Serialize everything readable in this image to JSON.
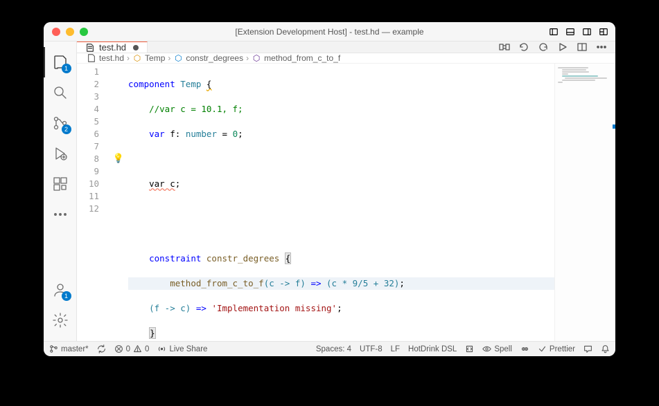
{
  "title": "[Extension Development Host] - test.hd — example",
  "badges": {
    "explorer": "1",
    "scm": "2",
    "accounts": "1"
  },
  "tab": {
    "label": "test.hd"
  },
  "breadcrumbs": {
    "file": "test.hd",
    "sym1": "Temp",
    "sym2": "constr_degrees",
    "sym3": "method_from_c_to_f"
  },
  "code": {
    "kw_component": "component",
    "name_temp": "Temp",
    "brace_open": "{",
    "cmt1": "//var c = 10.1, f;",
    "kw_var1": "var",
    "id_f": "f",
    "colon": ":",
    "type_num": "number",
    "eq": "=",
    "zero": "0",
    "semi": ";",
    "id_var_c": "var c",
    "kw_constraint": "constraint",
    "name_constr": "constr_degrees",
    "method_name": "method_from_c_to_f",
    "sig_cf": "(c -> f)",
    "arrow": "=>",
    "expr": "(c * 9/5 + 32)",
    "sig_fc": "(f -> c)",
    "str_missing": "'Implementation missing'",
    "brace_match": "{",
    "brace_match2": "}",
    "brace_close": "}"
  },
  "lines": {
    "l1": "1",
    "l2": "2",
    "l3": "3",
    "l4": "4",
    "l5": "5",
    "l6": "6",
    "l7": "7",
    "l8": "8",
    "l9": "9",
    "l10": "10",
    "l11": "11",
    "l12": "12"
  },
  "statusbar": {
    "branch": "master*",
    "errors": "0",
    "warnings": "0",
    "liveshare": "Live Share",
    "spaces": "Spaces: 4",
    "encoding": "UTF-8",
    "eol": "LF",
    "lang": "HotDrink DSL",
    "spell": "Spell",
    "prettier": "Prettier"
  }
}
